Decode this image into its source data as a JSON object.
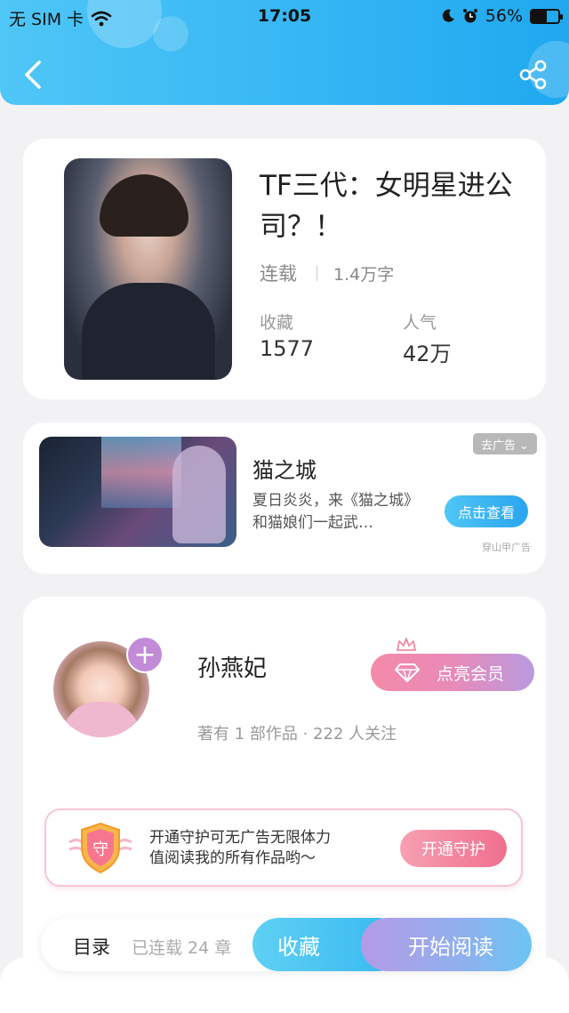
{
  "status_bar": {
    "carrier": "无 SIM 卡",
    "time": "17:05",
    "battery_pct": "56%",
    "battery_level": 0.56,
    "icons": [
      "wifi-icon",
      "moon-icon",
      "alarm-icon",
      "battery-icon"
    ]
  },
  "header": {
    "back_icon": "chevron-left-icon",
    "share_icon": "share-icon"
  },
  "book": {
    "title": "TF三代：女明星进公司？！",
    "status": "连载",
    "word_count": "1.4万字",
    "favorites_label": "收藏",
    "favorites_value": "1577",
    "popularity_label": "人气",
    "popularity_value": "42万"
  },
  "ad": {
    "remove_label": "去广告 ⌄",
    "title": "猫之城",
    "description": "夏日炎炎，来《猫之城》和猫娘们一起武…",
    "cta_label": "点击查看",
    "source": "穿山甲广告"
  },
  "author": {
    "name": "孙燕妃",
    "info": "著有 1 部作品 · 222 人关注",
    "follow_symbol": "+",
    "vip_label": "点亮会员"
  },
  "guard": {
    "badge_char": "守",
    "text_line1": "开通守护可无广告无限体力",
    "text_line2": "值阅读我的所有作品哟～",
    "button_label": "开通守护"
  },
  "bottom_bar": {
    "toc_label": "目录",
    "chapters_label": "已连载 24 章",
    "collect_label": "收藏",
    "read_label": "开始阅读"
  },
  "colors": {
    "header_gradient_start": "#4fc6f6",
    "header_gradient_end": "#1fa8ef",
    "vip_gradient_start": "#f48aa8",
    "vip_gradient_end": "#b89ae0",
    "guard_button": "#f06f8f",
    "collect_button": "#36b8f0",
    "read_button_start": "#b49be6"
  }
}
